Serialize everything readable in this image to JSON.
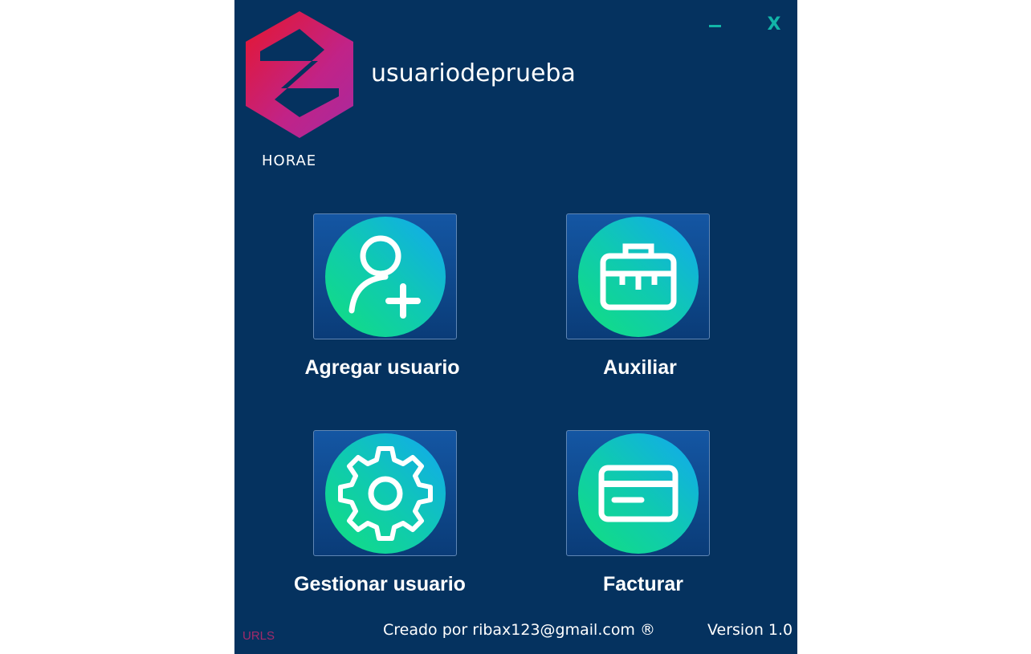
{
  "window": {
    "minimize_icon": "minimize-icon",
    "close_label": "X"
  },
  "header": {
    "brand": "HORAE",
    "username": "usuariodeprueba",
    "logo_colors": [
      "#e6162d",
      "#c12387",
      "#a72aa0"
    ]
  },
  "tiles": [
    {
      "label": "Agregar usuario",
      "icon": "add-user-icon"
    },
    {
      "label": "Auxiliar",
      "icon": "toolbox-icon"
    },
    {
      "label": "Gestionar usuario",
      "icon": "gear-icon"
    },
    {
      "label": "Facturar",
      "icon": "credit-card-icon"
    }
  ],
  "footer": {
    "link_label": "URLS",
    "credit": "Creado por ribax123@gmail.com ®",
    "version": "Version 1.0"
  },
  "colors": {
    "background": "#05325f",
    "accent": "#12b5a8",
    "link": "#a22a6a"
  }
}
